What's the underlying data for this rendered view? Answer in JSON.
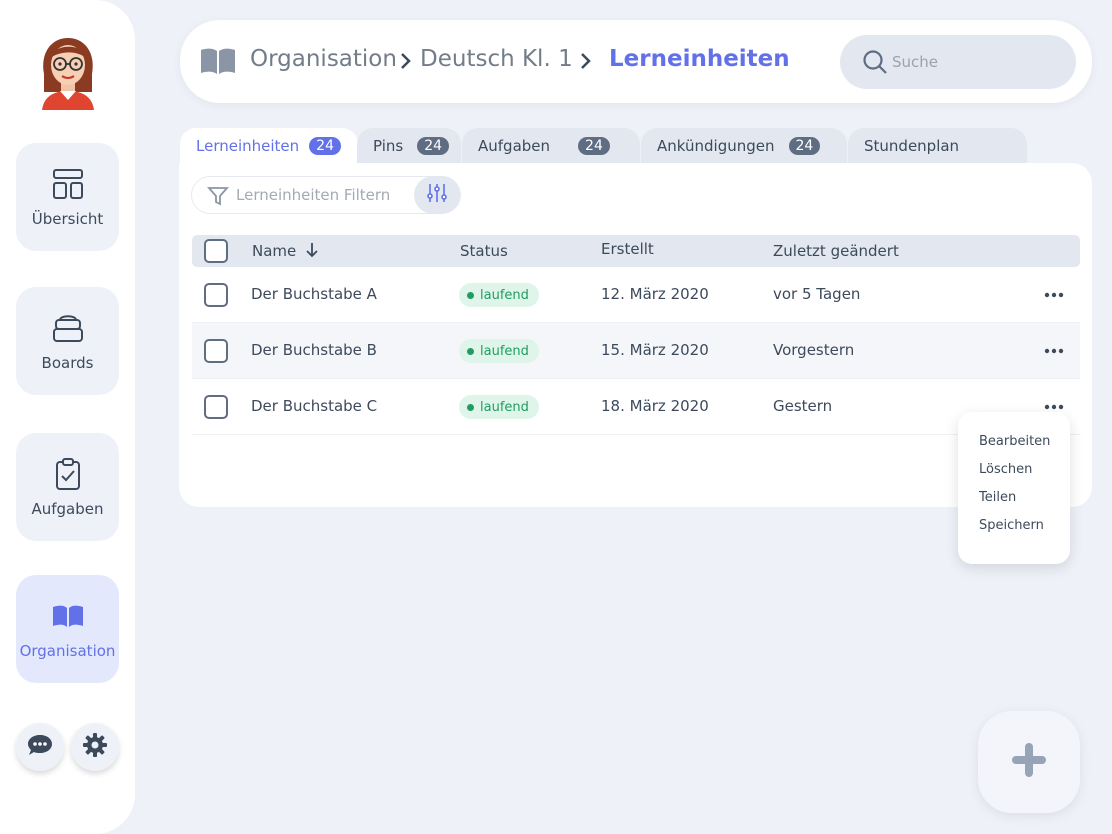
{
  "colors": {
    "accent": "#6271e8",
    "status_running": "#1f9d63"
  },
  "sidebar": {
    "items": [
      {
        "label": "Übersicht",
        "icon": "layout-icon"
      },
      {
        "label": "Boards",
        "icon": "stack-icon"
      },
      {
        "label": "Aufgaben",
        "icon": "clipboard-check-icon"
      },
      {
        "label": "Organisation",
        "icon": "book-open-icon",
        "active": true
      }
    ]
  },
  "header": {
    "breadcrumb": [
      "Organisation",
      "Deutsch Kl. 1",
      "Lerneinheiten"
    ],
    "search_placeholder": "Suche"
  },
  "tabs": [
    {
      "label": "Lerneinheiten",
      "count": "24",
      "active": true
    },
    {
      "label": "Pins",
      "count": "24"
    },
    {
      "label": "Aufgaben",
      "count": "24"
    },
    {
      "label": "Ankündigungen",
      "count": "24"
    },
    {
      "label": "Stundenplan"
    }
  ],
  "filter": {
    "placeholder": "Lerneinheiten Filtern"
  },
  "table": {
    "headers": {
      "name": "Name",
      "status": "Status",
      "created": "Erstellt",
      "modified": "Zuletzt geändert"
    },
    "rows": [
      {
        "name": "Der Buchstabe A",
        "status": "laufend",
        "created": "12. März 2020",
        "modified": "vor 5 Tagen"
      },
      {
        "name": "Der Buchstabe B",
        "status": "laufend",
        "created": "15. März 2020",
        "modified": "Vorgestern"
      },
      {
        "name": "Der Buchstabe C",
        "status": "laufend",
        "created": "18. März 2020",
        "modified": "Gestern"
      }
    ]
  },
  "context_menu": {
    "items": [
      "Bearbeiten",
      "Löschen",
      "Teilen",
      "Speichern"
    ]
  }
}
